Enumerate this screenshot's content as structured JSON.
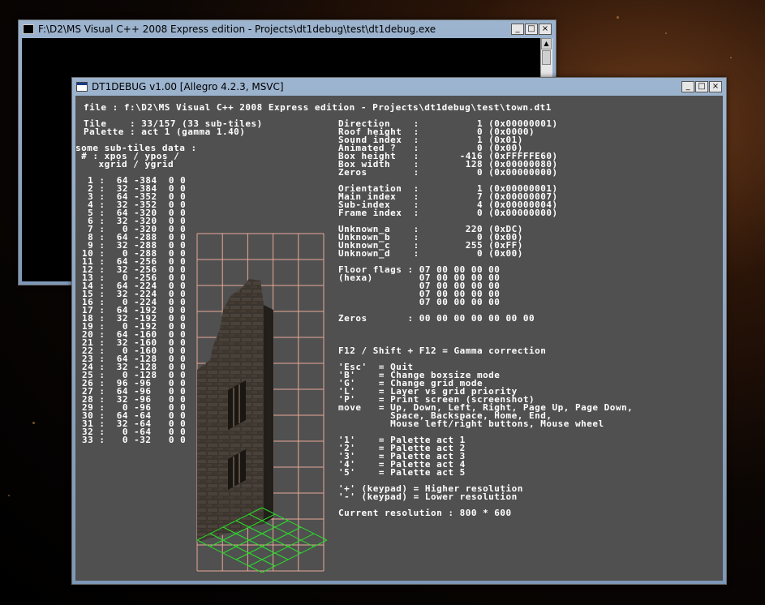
{
  "console_window": {
    "title": "F:\\D2\\MS Visual C++ 2008 Express edition - Projects\\dt1debug\\test\\dt1debug.exe",
    "icon": "console-icon",
    "buttons": {
      "minimize": "_",
      "maximize": "□",
      "close": "×"
    },
    "scroll_up": "▲"
  },
  "app_window": {
    "title": "DT1DEBUG v1.00 [Allegro 4.2.3, MSVC]",
    "icon": "app-icon",
    "buttons": {
      "minimize": "_",
      "maximize": "□",
      "close": "×"
    },
    "file_line": "file : f:\\D2\\MS Visual C++ 2008 Express edition - Projects\\dt1debug\\test\\town.dt1",
    "tile_line": "Tile    : 33/157 (33 sub-tiles)",
    "palette_line": "Palette : act 1 (gamma 1.40)",
    "subtiles_header": "some sub-tiles data :",
    "subtiles_cols_1": " # : xpos / ypos /",
    "subtiles_cols_2": "    xgrid / ygrid",
    "subtiles": [
      " 1 :  64 -384  0 0",
      " 2 :  32 -384  0 0",
      " 3 :  64 -352  0 0",
      " 4 :  32 -352  0 0",
      " 5 :  64 -320  0 0",
      " 6 :  32 -320  0 0",
      " 7 :   0 -320  0 0",
      " 8 :  64 -288  0 0",
      " 9 :  32 -288  0 0",
      "10 :   0 -288  0 0",
      "11 :  64 -256  0 0",
      "12 :  32 -256  0 0",
      "13 :   0 -256  0 0",
      "14 :  64 -224  0 0",
      "15 :  32 -224  0 0",
      "16 :   0 -224  0 0",
      "17 :  64 -192  0 0",
      "18 :  32 -192  0 0",
      "19 :   0 -192  0 0",
      "20 :  64 -160  0 0",
      "21 :  32 -160  0 0",
      "22 :   0 -160  0 0",
      "23 :  64 -128  0 0",
      "24 :  32 -128  0 0",
      "25 :   0 -128  0 0",
      "26 :  96 -96   0 0",
      "27 :  64 -96   0 0",
      "28 :  32 -96   0 0",
      "29 :   0 -96   0 0",
      "30 :  64 -64   0 0",
      "31 :  32 -64   0 0",
      "32 :   0 -64   0 0",
      "33 :   0 -32   0 0"
    ],
    "props_1": [
      "Direction    :          1 (0x00000001)",
      "Roof height  :          0 (0x0000)",
      "Sound index  :          1 (0x01)",
      "Animated ?   :          0 (0x00)",
      "Box height   :       -416 (0xFFFFFE60)",
      "Box width    :        128 (0x00000080)",
      "Zeros        :          0 (0x00000000)"
    ],
    "props_2": [
      "Orientation  :          1 (0x00000001)",
      "Main index   :          7 (0x00000007)",
      "Sub-index    :          4 (0x00000004)",
      "Frame index  :          0 (0x00000000)"
    ],
    "props_3": [
      "Unknown_a    :        220 (0xDC)",
      "Unknown_b    :          0 (0x00)",
      "Unknown_c    :        255 (0xFF)",
      "Unknown_d    :          0 (0x00)"
    ],
    "floor_flags": [
      "Floor flags : 07 00 00 00 00",
      "(hexa)        07 00 00 00 00",
      "              07 00 00 00 00",
      "              07 00 00 00 00",
      "              07 00 00 00 00"
    ],
    "zeros_line": "Zeros       : 00 00 00 00 00 00 00",
    "gamma_line": "F12 / Shift + F12 = Gamma correction",
    "keys": [
      "'Esc'  = Quit",
      "'B'    = Change boxsize mode",
      "'G'    = Change grid mode",
      "'L'    = Layer vs grid priority",
      "'P'    = Print screen (screenshot)",
      "move   = Up, Down, Left, Right, Page Up, Page Down,",
      "         Space, Backspace, Home, End,",
      "         Mouse left/right buttons, Mouse wheel"
    ],
    "palettes": [
      "'1'    = Palette act 1",
      "'2'    = Palette act 2",
      "'3'    = Palette act 3",
      "'4'    = Palette act 4",
      "'5'    = Palette act 5"
    ],
    "resolution_keys": [
      "'+' (keypad) = Higher resolution",
      "'-' (keypad) = Lower resolution"
    ],
    "current_resolution": "Current resolution : 800 * 600",
    "colors": {
      "background": "#505050",
      "text": "#ffffff",
      "box_grid": "#e8a898",
      "floor_grid": "#28e028"
    }
  }
}
